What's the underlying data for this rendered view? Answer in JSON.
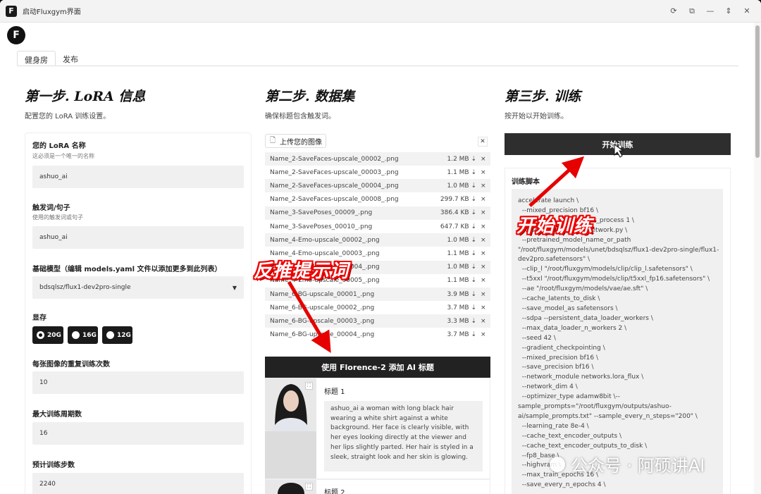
{
  "window": {
    "title": "启动Fluxgym界面",
    "logo_letter": "F"
  },
  "tabs": [
    {
      "label": "健身房"
    },
    {
      "label": "发布"
    }
  ],
  "step1": {
    "title": "第一步. LoRA 信息",
    "subtitle": "配置您的 LoRA 训练设置。",
    "lora_name": {
      "label": "您的 LoRA 名称",
      "hint": "这必须是一个唯一的名称",
      "value": "ashuo_ai"
    },
    "trigger": {
      "label": "触发词/句子",
      "hint": "使用的触发词或句子",
      "value": "ashuo_ai"
    },
    "base_model": {
      "label": "基础模型（编辑 models.yaml 文件以添加更多到此列表）",
      "value": "bdsqlsz/flux1-dev2pro-single"
    },
    "vram": {
      "label": "显存",
      "options": [
        "20G",
        "16G",
        "12G"
      ],
      "selected": "20G"
    },
    "repeats": {
      "label": "每张图像的重复训练次数",
      "value": "10"
    },
    "epochs": {
      "label": "最大训练周期数",
      "value": "16"
    },
    "steps": {
      "label": "预计训练步数",
      "value": "2240"
    }
  },
  "step2": {
    "title": "第二步. 数据集",
    "subtitle": "确保标题包含触发词。",
    "upload_label": "上传您的图像",
    "files": [
      {
        "name": "Name_2-SaveFaces-upscale_00002_.png",
        "size": "1.2 MB ⇣"
      },
      {
        "name": "Name_2-SaveFaces-upscale_00003_.png",
        "size": "1.1 MB ⇣"
      },
      {
        "name": "Name_2-SaveFaces-upscale_00004_.png",
        "size": "1.0 MB ⇣"
      },
      {
        "name": "Name_2-SaveFaces-upscale_00008_.png",
        "size": "299.7 KB ⇣"
      },
      {
        "name": "Name_3-SavePoses_00009_.png",
        "size": "386.4 KB ⇣"
      },
      {
        "name": "Name_3-SavePoses_00010_.png",
        "size": "647.7 KB ⇣"
      },
      {
        "name": "Name_4-Emo-upscale_00002_.png",
        "size": "1.0 MB ⇣"
      },
      {
        "name": "Name_4-Emo-upscale_00003_.png",
        "size": "1.1 MB ⇣"
      },
      {
        "name": "Name_4-Emo-upscale_00004_.png",
        "size": "1.0 MB ⇣"
      },
      {
        "name": "Name_4-Emo-upscale_00005_.png",
        "size": "1.1 MB ⇣"
      },
      {
        "name": "Name_6-BG-upscale_00001_.png",
        "size": "3.9 MB ⇣"
      },
      {
        "name": "Name_6-BG-upscale_00002_.png",
        "size": "3.7 MB ⇣"
      },
      {
        "name": "Name_6-BG-upscale_00003_.png",
        "size": "3.3 MB ⇣"
      },
      {
        "name": "Name_6-BG-upscale_00004_.png",
        "size": "3.7 MB ⇣"
      }
    ],
    "florence_button": "使用 Florence-2 添加 AI 标题",
    "captions": [
      {
        "label": "标题 1",
        "text": "ashuo_ai a woman with long black hair wearing a white shirt against a white background. Her face is clearly visible, with her eyes looking directly at the viewer and her lips slightly parted. Her hair is styled in a sleek, straight look and her skin is glowing."
      },
      {
        "label": "标题 2",
        "text": ""
      }
    ]
  },
  "step3": {
    "title": "第三步. 训练",
    "subtitle": "按开始以开始训练。",
    "start_button": "开始训练",
    "script_label": "训练脚本",
    "script": "accelerate launch \\\n  --mixed_precision bf16 \\\n  --num_cpu_threads_per_process 1 \\\n  sd-scripts/flux_train_network.py \\\n  --pretrained_model_name_or_path\n\"/root/fluxgym/models/unet/bdsqlsz/flux1-dev2pro-single/flux1-\ndev2pro.safetensors\" \\\n  --clip_l \"/root/fluxgym/models/clip/clip_l.safetensors\" \\\n  --t5xxl \"/root/fluxgym/models/clip/t5xxl_fp16.safetensors\" \\\n  --ae \"/root/fluxgym/models/vae/ae.sft\" \\\n  --cache_latents_to_disk \\\n  --save_model_as safetensors \\\n  --sdpa --persistent_data_loader_workers \\\n  --max_data_loader_n_workers 2 \\\n  --seed 42 \\\n  --gradient_checkpointing \\\n  --mixed_precision bf16 \\\n  --save_precision bf16 \\\n  --network_module networks.lora_flux \\\n  --network_dim 4 \\\n  --optimizer_type adamw8bit \\--\nsample_prompts=\"/root/fluxgym/outputs/ashuo-\nai/sample_prompts.txt\" --sample_every_n_steps=\"200\" \\\n  --learning_rate 8e-4 \\\n  --cache_text_encoder_outputs \\\n  --cache_text_encoder_outputs_to_disk \\\n  --fp8_base \\\n  --highvram \\\n  --max_train_epochs 16 \\\n  --save_every_n_epochs 4 \\"
  },
  "annotations": {
    "reverse_prompt": "反推提示词",
    "start_training": "开始训练",
    "arrow_color": "#e60000"
  },
  "watermark": "公众号 · 阿硕讲AI"
}
